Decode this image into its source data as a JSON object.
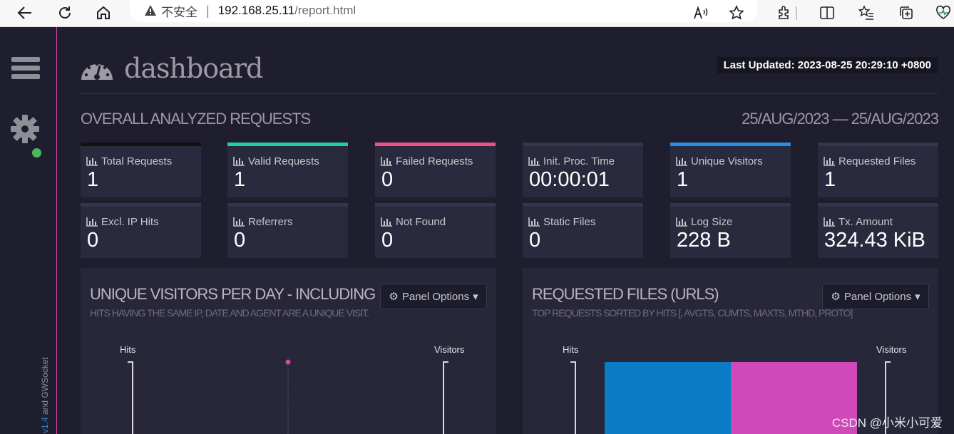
{
  "browser": {
    "insecure_label": "不安全",
    "url_host": "192.168.25.11",
    "url_path": "/report.html"
  },
  "sidebar": {
    "version_prefix": "v1.4",
    "version_suffix": " and GWSocket"
  },
  "header": {
    "title": "dashboard",
    "last_updated_label": "Last Updated: 2023-08-25 20:29:10 +0800"
  },
  "overview": {
    "heading": "OVERALL ANALYZED REQUESTS",
    "date_range": "25/AUG/2023 — 25/AUG/2023",
    "cards": [
      {
        "label": "Total Requests",
        "value": "1",
        "accent": "#111111"
      },
      {
        "label": "Valid Requests",
        "value": "1",
        "accent": "#1ed0a8"
      },
      {
        "label": "Failed Requests",
        "value": "0",
        "accent": "#ef4f86"
      },
      {
        "label": "Init. Proc. Time",
        "value": "00:00:01",
        "accent": "#33344d"
      },
      {
        "label": "Unique Visitors",
        "value": "1",
        "accent": "#2b8ce6"
      },
      {
        "label": "Requested Files",
        "value": "1",
        "accent": "#33344d"
      },
      {
        "label": "Excl. IP Hits",
        "value": "0",
        "accent": "#33344d"
      },
      {
        "label": "Referrers",
        "value": "0",
        "accent": "#33344d"
      },
      {
        "label": "Not Found",
        "value": "0",
        "accent": "#33344d"
      },
      {
        "label": "Static Files",
        "value": "0",
        "accent": "#33344d"
      },
      {
        "label": "Log Size",
        "value": "228 B",
        "accent": "#33344d"
      },
      {
        "label": "Tx. Amount",
        "value": "324.43 KiB",
        "accent": "#33344d"
      }
    ]
  },
  "panels": [
    {
      "title": "UNIQUE VISITORS PER DAY - INCLUDING",
      "subtitle": "HITS HAVING THE SAME IP, DATE AND AGENT ARE A UNIQUE VISIT.",
      "options_label": "Panel Options",
      "y_left": "Hits",
      "y_right": "Visitors"
    },
    {
      "title": "REQUESTED FILES (URLS)",
      "subtitle": "TOP REQUESTS SORTED BY HITS [, AVGTS, CUMTS, MAXTS, MTHD, PROTO]",
      "options_label": "Panel Options",
      "y_left": "Hits",
      "y_right": "Visitors"
    }
  ],
  "chart_data": [
    {
      "type": "line",
      "xlabel": "",
      "ylabel": "Hits",
      "series": [
        {
          "name": "Hits",
          "values": [
            1
          ]
        },
        {
          "name": "Visitors",
          "values": [
            1
          ]
        }
      ]
    },
    {
      "type": "bar",
      "ylabel": "Hits",
      "series": [
        {
          "name": "Hits",
          "values": [
            1
          ],
          "color": "#0a7bc4"
        },
        {
          "name": "Visitors",
          "values": [
            1
          ],
          "color": "#d148b9"
        }
      ]
    }
  ],
  "watermark": "CSDN @小米小可爱"
}
